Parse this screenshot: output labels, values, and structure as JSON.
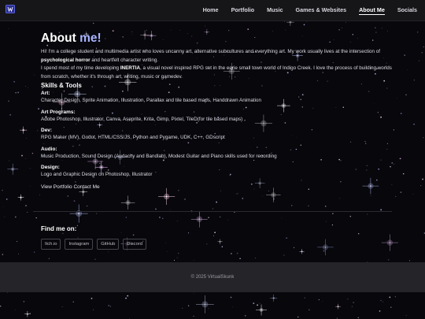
{
  "nav": {
    "links": [
      "Home",
      "Portfolio",
      "Music",
      "Games & Websites",
      "About Me",
      "Socials"
    ],
    "active": "About Me"
  },
  "about": {
    "title_prefix": "About",
    "title_accent": "me!",
    "intro_1a": "Hi! I'm a college student and multimedia artist who loves uncanny art, alternative subcultures and everything art. My work usually lives at the intersection of ",
    "intro_1b": "psychological horror",
    "intro_1c": " and heartfelt character writing.",
    "intro_2a": "I spend most of my time developing ",
    "intro_2b": "INERTIA",
    "intro_2c": ", a visual novel inspired RPG set in the eerie small town world of Indigo Creek. I love the process of building worlds from scratch, whether it's through art, writing, music or gamedev."
  },
  "skills": {
    "heading": "Skills & Tools",
    "items": [
      {
        "name": "Art:",
        "value": "Character Design, Sprite Animation, Illustration, Parallax and tile based maps, Handdrawn Animation"
      },
      {
        "name": "Art Programs:",
        "value": "Adobe Photoshop, Illustrator, Canva, Aseprite, Krita, Gimp, Pixtel, TileD(for tile based maps)"
      },
      {
        "name": "Dev:",
        "value": "RPG Maker (MV), Godot, HTML/CSS/JS, Python and Pygame, UDK, C++, GDscript"
      },
      {
        "name": "Audio:",
        "value": "Music Production, Sound Design (Audacity and Bandlab), Modest Guitar and Piano skills used for recording"
      },
      {
        "name": "Design:",
        "value": "Logo and Graphic Design on Photoshop, Illustrator"
      }
    ]
  },
  "links": {
    "portfolio": "View Portfolio",
    "contact": "Contact Me"
  },
  "findme": {
    "heading": "Find me on:",
    "socials": [
      "Itch.io",
      "Instagram",
      "GitHub",
      "Discord"
    ]
  },
  "footer": {
    "text": "© 2025 VirtualSkunk"
  },
  "colors": {
    "accent": "#a9b4ff",
    "background": "#07070c",
    "navbar": "#161619",
    "footer": "#252529"
  }
}
